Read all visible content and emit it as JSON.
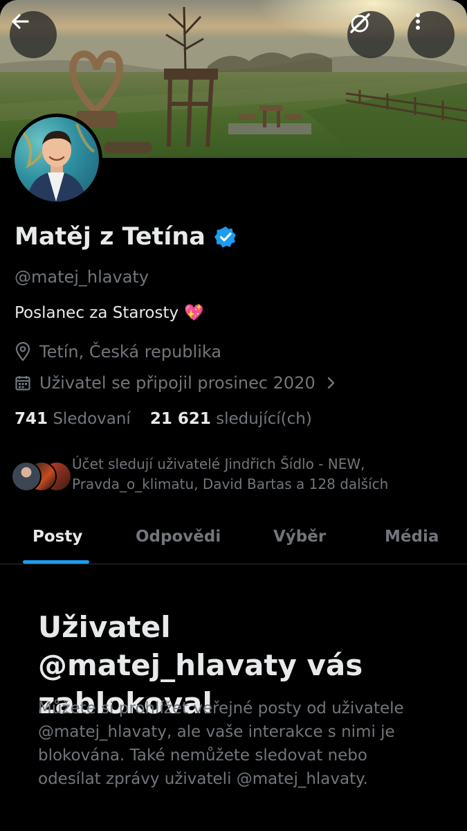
{
  "colors": {
    "background": "#000000",
    "text_primary": "#e7e9ea",
    "text_secondary": "#71767b",
    "accent": "#1d9bf0",
    "verified": "#1d9bf0"
  },
  "header": {
    "back_icon": "arrow-left-icon",
    "grok_icon": "grok-icon",
    "more_icon": "more-vertical-icon"
  },
  "profile": {
    "name": "Matěj z Tetína",
    "verified_icon": "verified-badge-icon",
    "handle": "@matej_hlavaty",
    "bio": "Poslanec za Starosty",
    "bio_emoji": "💖",
    "location": "Tetín, Česká republika",
    "joined": "Uživatel se připojil prosinec 2020",
    "following_count": "741",
    "following_label": "Sledovaní",
    "followers_count": "21 621",
    "followers_label": "sledující(ch)",
    "followed_by": "Účet sledují uživatelé Jindřich Šídlo - NEW, Pravda_o_klimatu, David Bartas a 128 dalších"
  },
  "tabs": [
    {
      "label": "Posty",
      "active": true
    },
    {
      "label": "Odpovědi",
      "active": false
    },
    {
      "label": "Výběr",
      "active": false
    },
    {
      "label": "Média",
      "active": false
    }
  ],
  "blocked": {
    "title": "Uživatel @matej_hlavaty vás zablokoval",
    "description": "Můžete si prohlížet veřejné posty od uživatele @matej_hlavaty, ale vaše interakce s nimi je blokována. Také nemůžete sledovat nebo odesílat zprávy uživateli @matej_hlavaty."
  }
}
